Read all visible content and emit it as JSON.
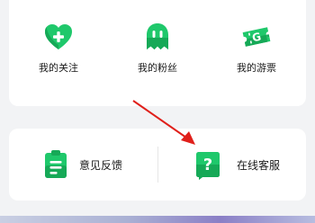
{
  "quick_links": {
    "follows": {
      "label": "我的关注",
      "icon": "heart-plus-icon"
    },
    "fans": {
      "label": "我的粉丝",
      "icon": "ghost-icon"
    },
    "tickets": {
      "label": "我的游票",
      "icon": "ticket-icon"
    }
  },
  "services": {
    "feedback": {
      "label": "意见反馈",
      "icon": "clipboard-icon"
    },
    "support": {
      "label": "在线客服",
      "icon": "question-icon"
    }
  },
  "annotation": {
    "color": "#e0201b",
    "points_to": "在线客服"
  },
  "colors": {
    "accent_green": "#1fc86b",
    "accent_green_dark": "#16a957"
  }
}
